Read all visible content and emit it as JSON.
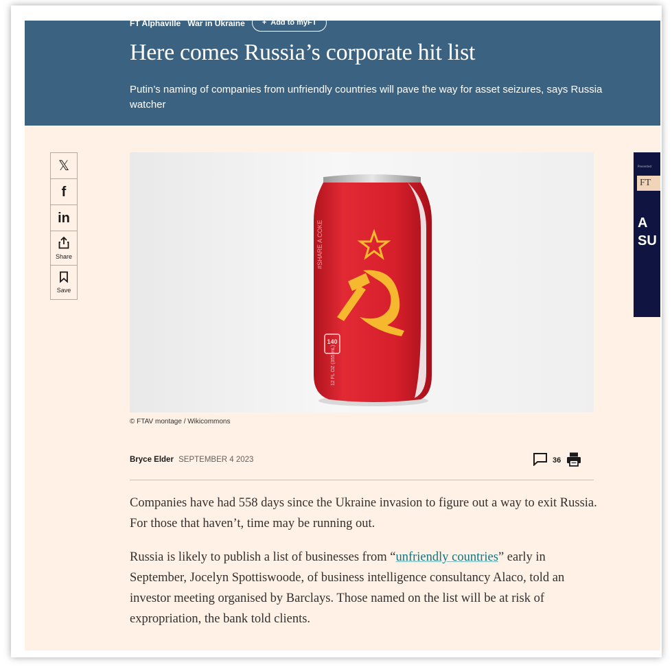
{
  "header": {
    "tags": [
      "FT Alphaville",
      "War in Ukraine"
    ],
    "add_label": "Add to myFT",
    "headline": "Here comes Russia’s corporate hit list",
    "standfirst": "Putin’s naming of companies from unfriendly countries will pave the way for asset seizures, says Russia watcher"
  },
  "share": {
    "x_glyph": "𝕏",
    "facebook_glyph": "f",
    "linkedin_glyph": "in",
    "share_label": "Share",
    "save_label": "Save"
  },
  "hero": {
    "can_text": "#SHARE A COKE",
    "calories": "140",
    "cal_label": "CALORIES PER CAN",
    "volume": "12 FL OZ (355 mL)"
  },
  "caption": "© FTAV montage / Wikicommons",
  "byline": {
    "author": "Bryce Elder",
    "date": "SEPTEMBER 4 2023",
    "comment_count": "36"
  },
  "body": {
    "p1": "Companies have had 558 days since the Ukraine invasion to figure out a way to exit Russia. For those that haven’t, time may be running out.",
    "p2_before": "Russia is likely to publish a list of businesses from “",
    "p2_link": "unfriendly countries",
    "p2_after": "” early in September, Jocelyn Spottiswoode, of business intelligence consultancy Alaco, told an investor meeting organised by Barclays. Those named on the list will be at risk of expropriation, the bank told clients."
  },
  "ad": {
    "presented": "Presented",
    "logo": "FT",
    "text": "A\nSU"
  },
  "colors": {
    "header_bg": "#3c6281",
    "page_bg": "#fff1e5",
    "link": "#0d7680",
    "can_red": "#d9242f",
    "emblem_gold": "#f5b82e",
    "ad_bg": "#0f1540"
  }
}
